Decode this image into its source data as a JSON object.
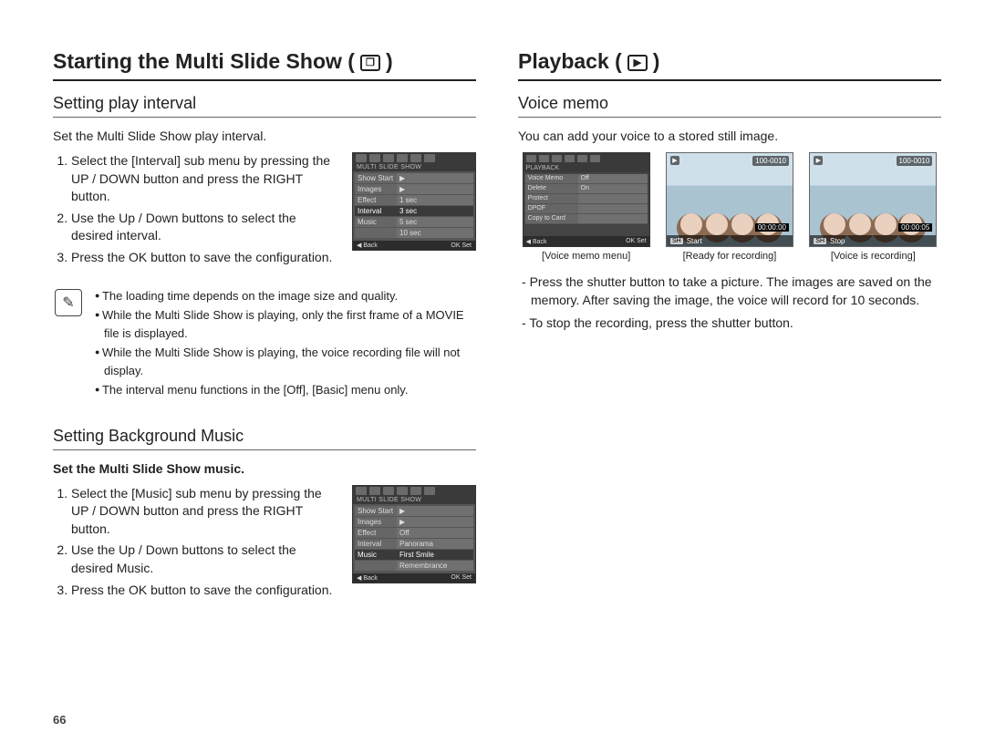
{
  "page_number": "66",
  "left": {
    "title": "Starting the Multi Slide Show (",
    "title_end": ")",
    "sec1": {
      "heading": "Setting play interval",
      "intro": "Set the Multi Slide Show play interval.",
      "steps": [
        "Select the [Interval] sub menu by pressing the UP / DOWN button and press the RIGHT button.",
        "Use the Up / Down buttons to select the desired interval.",
        "Press the OK button to save the configuration."
      ],
      "lcd": {
        "title": "MULTI SLIDE SHOW",
        "rows": [
          {
            "label": "Show Start",
            "value": "▶"
          },
          {
            "label": "Images",
            "value": "▶"
          },
          {
            "label": "Effect",
            "value": "1 sec"
          },
          {
            "label": "Interval",
            "value": "3 sec"
          },
          {
            "label": "Music",
            "value": "5 sec"
          },
          {
            "label": "",
            "value": "10 sec"
          }
        ],
        "foot_l": "◀ Back",
        "foot_r": "OK Set"
      },
      "notes": [
        "The loading time depends on the image size and quality.",
        "While the Multi Slide Show is playing, only the first frame of a MOVIE file is displayed.",
        "While the Multi Slide Show is playing, the voice recording file will not display.",
        "The interval menu functions in the [Off], [Basic] menu only."
      ]
    },
    "sec2": {
      "heading": "Setting Background Music",
      "intro": "Set the Multi Slide Show music.",
      "steps": [
        "Select the [Music] sub menu by pressing the UP / DOWN button and press the RIGHT button.",
        "Use the Up / Down buttons to select the desired Music.",
        "Press the OK button to save the configuration."
      ],
      "lcd": {
        "title": "MULTI SLIDE SHOW",
        "rows": [
          {
            "label": "Show Start",
            "value": "▶"
          },
          {
            "label": "Images",
            "value": "▶"
          },
          {
            "label": "Effect",
            "value": "Off"
          },
          {
            "label": "Interval",
            "value": "Panorama"
          },
          {
            "label": "Music",
            "value": "First Smile"
          },
          {
            "label": "",
            "value": "Remembrance"
          }
        ],
        "foot_l": "◀ Back",
        "foot_r": "OK Set"
      }
    }
  },
  "right": {
    "title": "Playback (",
    "title_end": ")",
    "sec1": {
      "heading": "Voice memo",
      "intro": "You can add your voice to a stored still image.",
      "shots": [
        {
          "type": "menu",
          "title": "PLAYBACK",
          "rows": [
            {
              "a": "Voice Memo",
              "b": "Off"
            },
            {
              "a": "Delete",
              "b": "On"
            },
            {
              "a": "Protect",
              "b": ""
            },
            {
              "a": "DPOF",
              "b": ""
            },
            {
              "a": "Copy to Card",
              "b": ""
            }
          ],
          "foot_l": "◀ Back",
          "foot_r": "OK Set",
          "caption": "[Voice memo menu]"
        },
        {
          "type": "photo",
          "tag": "100-0010",
          "timer": "00:00:00",
          "bar_key": "SH",
          "bar_label": "Start",
          "caption": "[Ready for recording]"
        },
        {
          "type": "photo",
          "tag": "100-0010",
          "timer": "00:00:05",
          "bar_key": "SH",
          "bar_label": "Stop",
          "caption": "[Voice is recording]"
        }
      ],
      "dash": [
        "Press the shutter button to take a picture. The images are saved on the memory. After saving the image, the voice will record for 10 seconds.",
        "To stop the recording, press the shutter button."
      ]
    }
  }
}
